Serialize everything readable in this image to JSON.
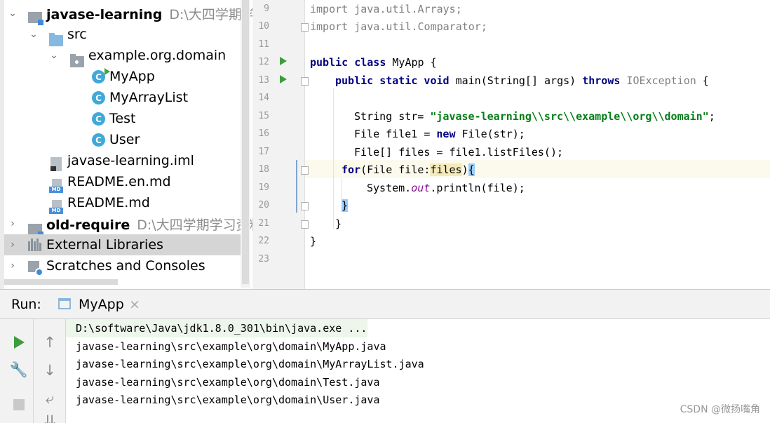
{
  "project": {
    "rows": [
      {
        "label": "javase-learning",
        "path": "D:\\大四学期学习资"
      },
      {
        "label": "src"
      },
      {
        "label": "example.org.domain"
      },
      {
        "label": "MyApp"
      },
      {
        "label": "MyArrayList"
      },
      {
        "label": "Test"
      },
      {
        "label": "User"
      },
      {
        "label": "javase-learning.iml"
      },
      {
        "label": "README.en.md"
      },
      {
        "label": "README.md"
      },
      {
        "label": "old-require",
        "path": "D:\\大四学期学习资料\\s"
      },
      {
        "label": "External Libraries"
      },
      {
        "label": "Scratches and Consoles"
      }
    ],
    "class_icon_letter": "C",
    "md_tag": "MD"
  },
  "editor": {
    "line_numbers": [
      "9",
      "10",
      "11",
      "12",
      "13",
      "14",
      "15",
      "16",
      "17",
      "18",
      "19",
      "20",
      "21",
      "22",
      "23"
    ],
    "code": {
      "l9_kw": "import",
      "l9_rest": " java.util.Arrays;",
      "l10_kw": "import",
      "l10_rest": " java.util.Comparator;",
      "l12_kw1": "public",
      "l12_kw2": "class",
      "l12_rest": " MyApp {",
      "l13_kw": "public static void",
      "l13_mid": " main(String[] args) ",
      "l13_throws": "throws",
      "l13_exc": " IOException",
      "l13_end": " {",
      "l15_pre": "String str= ",
      "l15_str": "\"javase-learning\\\\src\\\\example\\\\org\\\\domain\"",
      "l15_end": ";",
      "l16_pre": "File file1 = ",
      "l16_kw": "new",
      "l16_rest": " File(str);",
      "l17": "File[] files = file1.listFiles();",
      "l18_kw": "for",
      "l18_mid": "(File file:",
      "l18_ident": "files",
      "l18_close": ")",
      "l18_brace": "{",
      "l19_pre": "System.",
      "l19_out": "out",
      "l19_rest": ".println(file);",
      "l20": "}",
      "l21": "}",
      "l22": "}"
    }
  },
  "run": {
    "title": "Run:",
    "tab_name": "MyApp",
    "tab_close": "×",
    "tools": {
      "up": "↑",
      "down": "↓",
      "wrap": "⤶",
      "scroll": "⇊",
      "wrench": "🔧"
    },
    "console_lines": [
      "D:\\software\\Java\\jdk1.8.0_301\\bin\\java.exe ...",
      "javase-learning\\src\\example\\org\\domain\\MyApp.java",
      "javase-learning\\src\\example\\org\\domain\\MyArrayList.java",
      "javase-learning\\src\\example\\org\\domain\\Test.java",
      "javase-learning\\src\\example\\org\\domain\\User.java"
    ]
  },
  "watermark": "CSDN @微扬嘴角",
  "colors": {
    "keyword": "#000080",
    "string": "#067d17",
    "static_field": "#871094",
    "run_green": "#3d9d3d",
    "class_icon": "#3fa9d9",
    "selection": "#d5d5d5"
  }
}
